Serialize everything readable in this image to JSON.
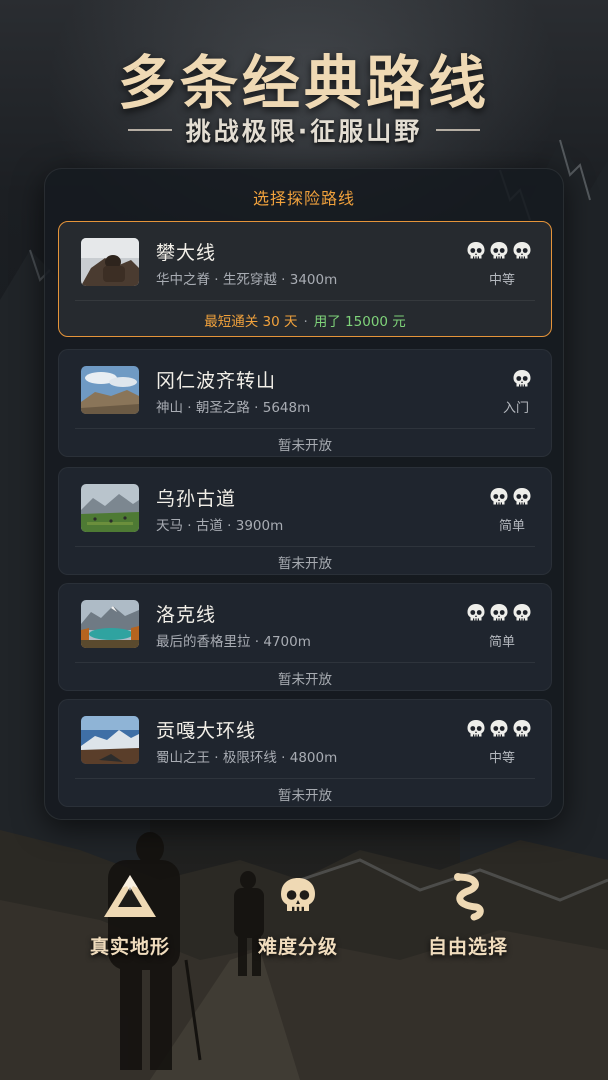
{
  "header": {
    "title": "多条经典路线",
    "subtitle": "挑战极限·征服山野"
  },
  "panel": {
    "title": "选择探险路线"
  },
  "routes": [
    {
      "name": "攀大线",
      "desc": "华中之脊 · 生死穿越 · 3400m",
      "skulls": 3,
      "difficulty": "中等",
      "record": {
        "shortest": "最短通关 30 天",
        "sep": "·",
        "cost": "用了 15000 元"
      },
      "selected": true
    },
    {
      "name": "冈仁波齐转山",
      "desc": "神山 · 朝圣之路 · 5648m",
      "skulls": 1,
      "difficulty": "入门",
      "status": "暂未开放"
    },
    {
      "name": "乌孙古道",
      "desc": "天马 · 古道 · 3900m",
      "skulls": 2,
      "difficulty": "简单",
      "status": "暂未开放"
    },
    {
      "name": "洛克线",
      "desc": "最后的香格里拉 · 4700m",
      "skulls": 3,
      "difficulty": "简单",
      "status": "暂未开放"
    },
    {
      "name": "贡嘎大环线",
      "desc": "蜀山之王 · 极限环线 · 4800m",
      "skulls": 3,
      "difficulty": "中等",
      "status": "暂未开放"
    }
  ],
  "features": [
    {
      "label": "真实地形",
      "icon": "mountain-icon"
    },
    {
      "label": "难度分级",
      "icon": "skull-icon"
    },
    {
      "label": "自由选择",
      "icon": "winding-path-icon"
    }
  ],
  "colors": {
    "accent_orange": "#f0a13c",
    "record_green": "#7fd37a",
    "title_gold": "#efd9b4"
  }
}
